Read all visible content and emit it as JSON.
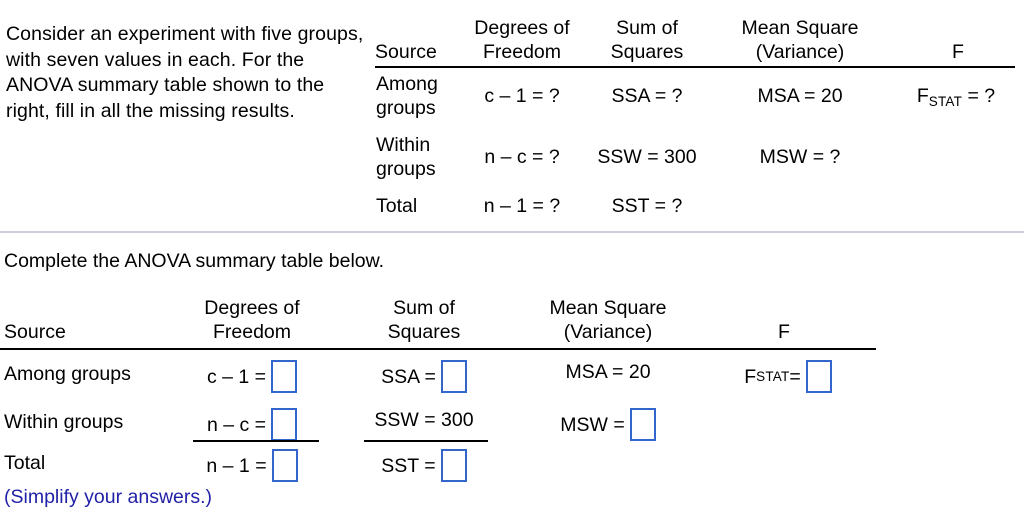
{
  "question": {
    "prompt": "Consider an experiment with five groups, with seven values in each. For the ANOVA summary table shown to the right, fill in all the missing results."
  },
  "top_table": {
    "headers": {
      "source": "Source",
      "df_line1": "Degrees of",
      "df_line2": "Freedom",
      "ss_line1": "Sum of",
      "ss_line2": "Squares",
      "ms_line1": "Mean Square",
      "ms_line2": "(Variance)",
      "f": "F"
    },
    "rows": [
      {
        "label_line1": "Among",
        "label_line2": "groups",
        "df": "c – 1 = ?",
        "ss": "SSA = ?",
        "ms": "MSA = 20",
        "f_prefix": "F",
        "f_sub": "STAT",
        "f_suffix": " = ?"
      },
      {
        "label_line1": "Within",
        "label_line2": "groups",
        "df": "n – c = ?",
        "ss": "SSW = 300",
        "ms": "MSW = ?",
        "f_prefix": "",
        "f_sub": "",
        "f_suffix": ""
      },
      {
        "label_line1": "Total",
        "label_line2": "",
        "df": "n – 1 = ?",
        "ss": "SST = ?",
        "ms": "",
        "f_prefix": "",
        "f_sub": "",
        "f_suffix": ""
      }
    ]
  },
  "instruction": "Complete the ANOVA summary table below.",
  "bottom_table": {
    "headers": {
      "source": "Source",
      "df_line1": "Degrees of",
      "df_line2": "Freedom",
      "ss_line1": "Sum of",
      "ss_line2": "Squares",
      "ms_line1": "Mean Square",
      "ms_line2": "(Variance)",
      "f": "F"
    },
    "rows": [
      {
        "label": "Among groups",
        "df_label": "c – 1 =",
        "df_value": "",
        "ss_label": "SSA =",
        "ss_value": "",
        "ms_label": "MSA = 20",
        "ms_value": null,
        "f_prefix": "F",
        "f_sub": "STAT",
        "f_eq": " =",
        "f_value": ""
      },
      {
        "label": "Within groups",
        "df_label": "n – c =",
        "df_value": "",
        "ss_label": "SSW = 300",
        "ss_value": null,
        "ms_label": "MSW =",
        "ms_value": "",
        "f_prefix": "",
        "f_sub": "",
        "f_eq": "",
        "f_value": null
      },
      {
        "label": "Total",
        "df_label": "n – 1 =",
        "df_value": "",
        "ss_label": "SST =",
        "ss_value": "",
        "ms_label": "",
        "ms_value": null,
        "f_prefix": "",
        "f_sub": "",
        "f_eq": "",
        "f_value": null
      }
    ]
  },
  "simplify_note": "(Simplify your answers.)",
  "colors": {
    "answer_box_border": "#3366cc",
    "note_text": "#2222a8",
    "divider": "#ccccdd",
    "rule": "#000000"
  }
}
